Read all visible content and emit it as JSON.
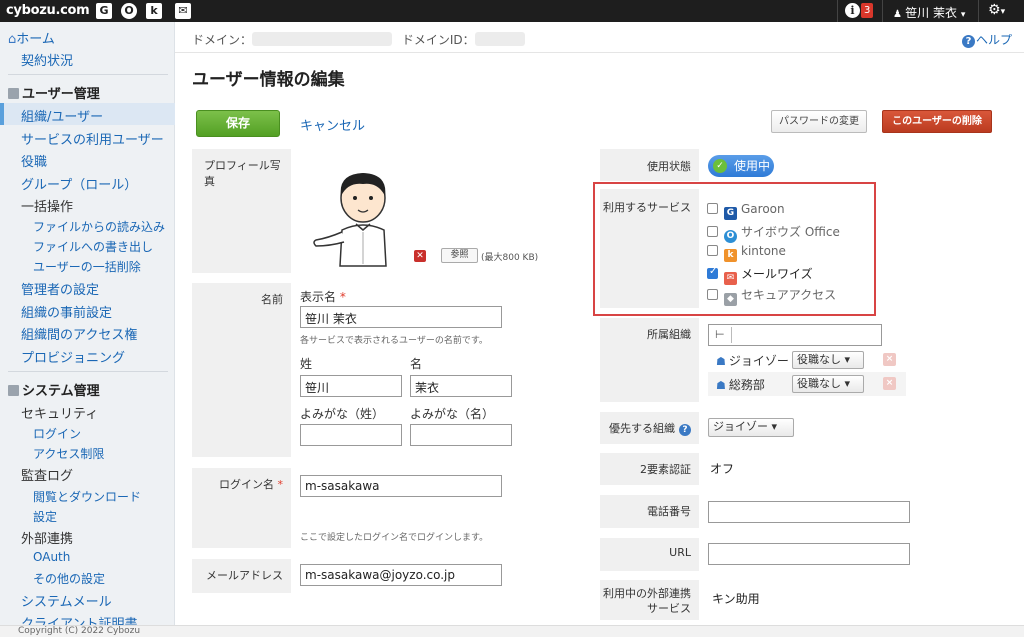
{
  "topbar": {
    "logo": "cybozu.com",
    "apps": [
      {
        "icon": "garoon-icon",
        "glyph": "G"
      },
      {
        "icon": "office-icon",
        "glyph": "O"
      },
      {
        "icon": "kintone-icon",
        "glyph": "k"
      },
      {
        "icon": "mail-icon",
        "glyph": "✉"
      }
    ],
    "info_glyph": "i",
    "notification_count": "3",
    "user_name": "笹川 茉衣",
    "user_caret": "▾",
    "gear_glyph": "⚙",
    "gear_caret": "▾"
  },
  "sidebar": {
    "home": "ホーム",
    "contract": "契約状況",
    "user_section": "ユーザー管理",
    "user_items": [
      "組織/ユーザー",
      "サービスの利用ユーザー",
      "役職",
      "グループ（ロール）",
      "一括操作"
    ],
    "bulk_subitems": [
      "ファイルからの読み込み",
      "ファイルへの書き出し",
      "ユーザーの一括削除"
    ],
    "user_items2": [
      "管理者の設定",
      "組織の事前設定",
      "組織間のアクセス権",
      "プロビジョニング"
    ],
    "system_section": "システム管理",
    "security": "セキュリティ",
    "security_subitems": [
      "ログイン",
      "アクセス制限"
    ],
    "audit": "監査ログ",
    "audit_subitems": [
      "閲覧とダウンロード",
      "設定"
    ],
    "external": "外部連携",
    "external_subitems": [
      "OAuth",
      "その他の設定"
    ],
    "system_mail": "システムメール",
    "client_cert": "クライアント証明書"
  },
  "footer": "Copyright (C) 2022 Cybozu",
  "header": {
    "domain_label": "ドメイン：",
    "domain_id_label": "ドメインID：",
    "help": "ヘルプ",
    "page_title": "ユーザー情報の編集"
  },
  "actions": {
    "save": "保存",
    "cancel": "キャンセル",
    "change_password": "パスワードの変更",
    "delete_user": "このユーザーの削除"
  },
  "profile": {
    "photo_label": "プロフィール写真",
    "browse": "参照",
    "max_size": "(最大800 KB)"
  },
  "name": {
    "label": "名前",
    "display_name_label": "表示名",
    "required_mark": "*",
    "display_name": "笹川 茉衣",
    "display_hint": "各サービスで表示されるユーザーの名前です。",
    "last_label": "姓",
    "first_label": "名",
    "last": "笹川",
    "first": "茉衣",
    "last_kana_label": "よみがな（姓）",
    "first_kana_label": "よみがな（名）",
    "last_kana": "",
    "first_kana": ""
  },
  "login": {
    "label": "ログイン名",
    "required_mark": "*",
    "value": "m-sasakawa",
    "hint": "ここで設定したログイン名でログインします。"
  },
  "email": {
    "label": "メールアドレス",
    "value": "m-sasakawa@joyzo.co.jp"
  },
  "status": {
    "label": "使用状態",
    "value": "使用中",
    "check_glyph": "✓"
  },
  "services": {
    "label": "利用するサービス",
    "items": [
      {
        "name": "Garoon",
        "checked": false,
        "icon": "garoon-icon",
        "glyph": "G",
        "color": "#1f5aa8"
      },
      {
        "name": "サイボウズ Office",
        "checked": false,
        "icon": "office-icon",
        "glyph": "O",
        "color": "#2d8fd5"
      },
      {
        "name": "kintone",
        "checked": false,
        "icon": "kintone-icon",
        "glyph": "k",
        "color": "#f0922b"
      },
      {
        "name": "メールワイズ",
        "checked": true,
        "icon": "mailwise-icon",
        "glyph": "✉",
        "color": "#e8604c"
      },
      {
        "name": "セキュアアクセス",
        "checked": false,
        "icon": "secure-access-icon",
        "glyph": "◆",
        "color": "#9aa0a6"
      }
    ]
  },
  "organization": {
    "label": "所属組織",
    "tree_glyph": "⊢",
    "org_glyph": "☗",
    "items": [
      {
        "name": "ジョイゾー",
        "role": "役職なし"
      },
      {
        "name": "総務部",
        "role": "役職なし"
      }
    ],
    "caret": "▾",
    "remove_glyph": "×"
  },
  "priority": {
    "label": "優先する組織",
    "help_glyph": "?",
    "value": "ジョイゾー",
    "caret": "▾"
  },
  "two_factor": {
    "label": "2要素認証",
    "value": "オフ"
  },
  "phone": {
    "label": "電話番号",
    "value": ""
  },
  "url": {
    "label": "URL",
    "value": ""
  },
  "external_services": {
    "label_line1": "利用中の外部連携",
    "label_line2": "サービス",
    "value": "キン助用"
  }
}
